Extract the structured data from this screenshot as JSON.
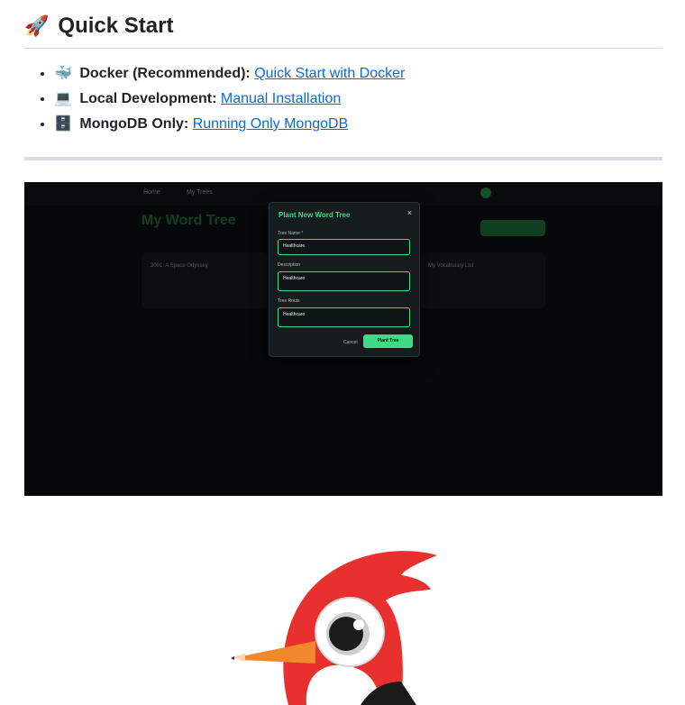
{
  "quick_start": {
    "heading_emoji": "🚀",
    "heading": "Quick Start",
    "items": [
      {
        "emoji": "🐳",
        "label": "Docker (Recommended):",
        "link": "Quick Start with Docker"
      },
      {
        "emoji": "💻",
        "label": "Local Development:",
        "link": "Manual Installation"
      },
      {
        "emoji": "🗄️",
        "label": "MongoDB Only:",
        "link": "Running Only MongoDB"
      }
    ]
  },
  "screenshot": {
    "nav_home": "Home",
    "nav_my_trees": "My Trees",
    "page_title": "My Word Tree",
    "card1_title": "2001: A Space Odyssey",
    "card2_title": "My Vocabulary List",
    "modal": {
      "title": "Plant New Word Tree",
      "close": "×",
      "tree_name_label": "Tree Name *",
      "tree_name_value": "Healthcare",
      "description_label": "Description",
      "description_value": "Healthcare",
      "tree_roots_label": "Tree Roots",
      "tree_roots_value": "Healthcare",
      "cancel": "Cancel",
      "plant": "Plant Tree"
    }
  },
  "colors": {
    "link": "#0969da",
    "accent_green": "#3ddc84",
    "mascot_red": "#e8312f",
    "beak_orange": "#f0892b"
  }
}
